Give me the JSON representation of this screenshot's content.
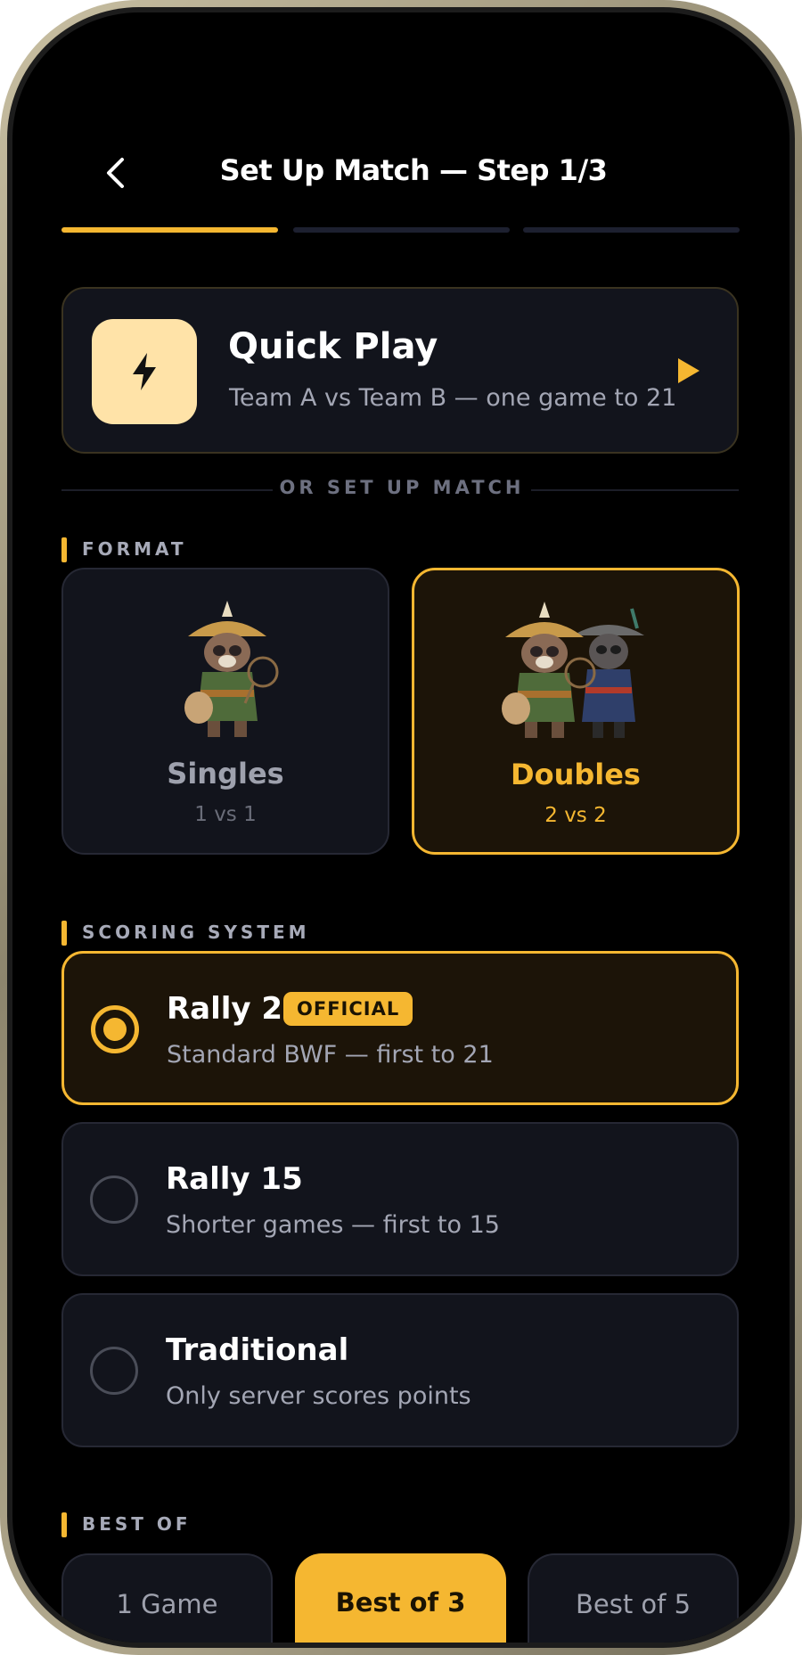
{
  "header": {
    "title": "Set Up Match — Step 1/3",
    "step_current": 1,
    "step_total": 3
  },
  "quick_play": {
    "title": "Quick Play",
    "subtitle": "Team A vs Team B — one game to 21"
  },
  "divider": {
    "label": "OR SET UP MATCH"
  },
  "format": {
    "label": "FORMAT",
    "options": [
      {
        "name": "Singles",
        "sub": "1 vs 1",
        "selected": false
      },
      {
        "name": "Doubles",
        "sub": "2 vs 2",
        "selected": true
      }
    ]
  },
  "scoring": {
    "label": "SCORING SYSTEM",
    "options": [
      {
        "title": "Rally 21",
        "badge": "OFFICIAL",
        "sub": "Standard BWF — first to 21",
        "selected": true
      },
      {
        "title": "Rally 15",
        "sub": "Shorter games — first to 15",
        "selected": false
      },
      {
        "title": "Traditional",
        "sub": "Only server scores points",
        "selected": false
      }
    ]
  },
  "best_of": {
    "label": "BEST OF",
    "options": [
      {
        "label": "1 Game",
        "selected": false
      },
      {
        "label": "Best of 3",
        "selected": true
      },
      {
        "label": "Best of 5",
        "selected": false
      }
    ]
  },
  "colors": {
    "accent": "#f5b731",
    "background": "#000000",
    "card": "#12141c",
    "selected_card": "#1c1408",
    "quick_icon_bg": "#ffe3a8"
  },
  "icons": {
    "back": "chevron-left-icon",
    "quick": "lightning-bolt-icon",
    "play": "play-icon"
  }
}
